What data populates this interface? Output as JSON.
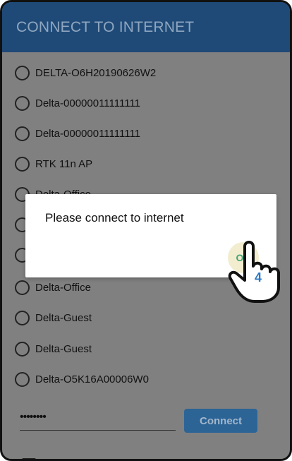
{
  "header": {
    "title": "CONNECT TO INTERNET"
  },
  "networks": [
    "DELTA-O6H20190626W2",
    "Delta-00000011111111",
    "Delta-00000011111111",
    "RTK 11n AP",
    "Delta-Office",
    "",
    "",
    "Delta-Office",
    "Delta-Guest",
    "Delta-Guest",
    "Delta-O5K16A00006W0"
  ],
  "password": {
    "value": "••••••••"
  },
  "connect_button": {
    "label": "Connect"
  },
  "dialog": {
    "message": "Please connect to internet",
    "ok_label": "OK"
  },
  "tutorial": {
    "step": "4"
  },
  "colors": {
    "header": "#1f4a78",
    "overlay": "#808080",
    "ok_text": "#3fa373",
    "connect_button": "#2c6496",
    "step_number": "#2d79c7"
  }
}
